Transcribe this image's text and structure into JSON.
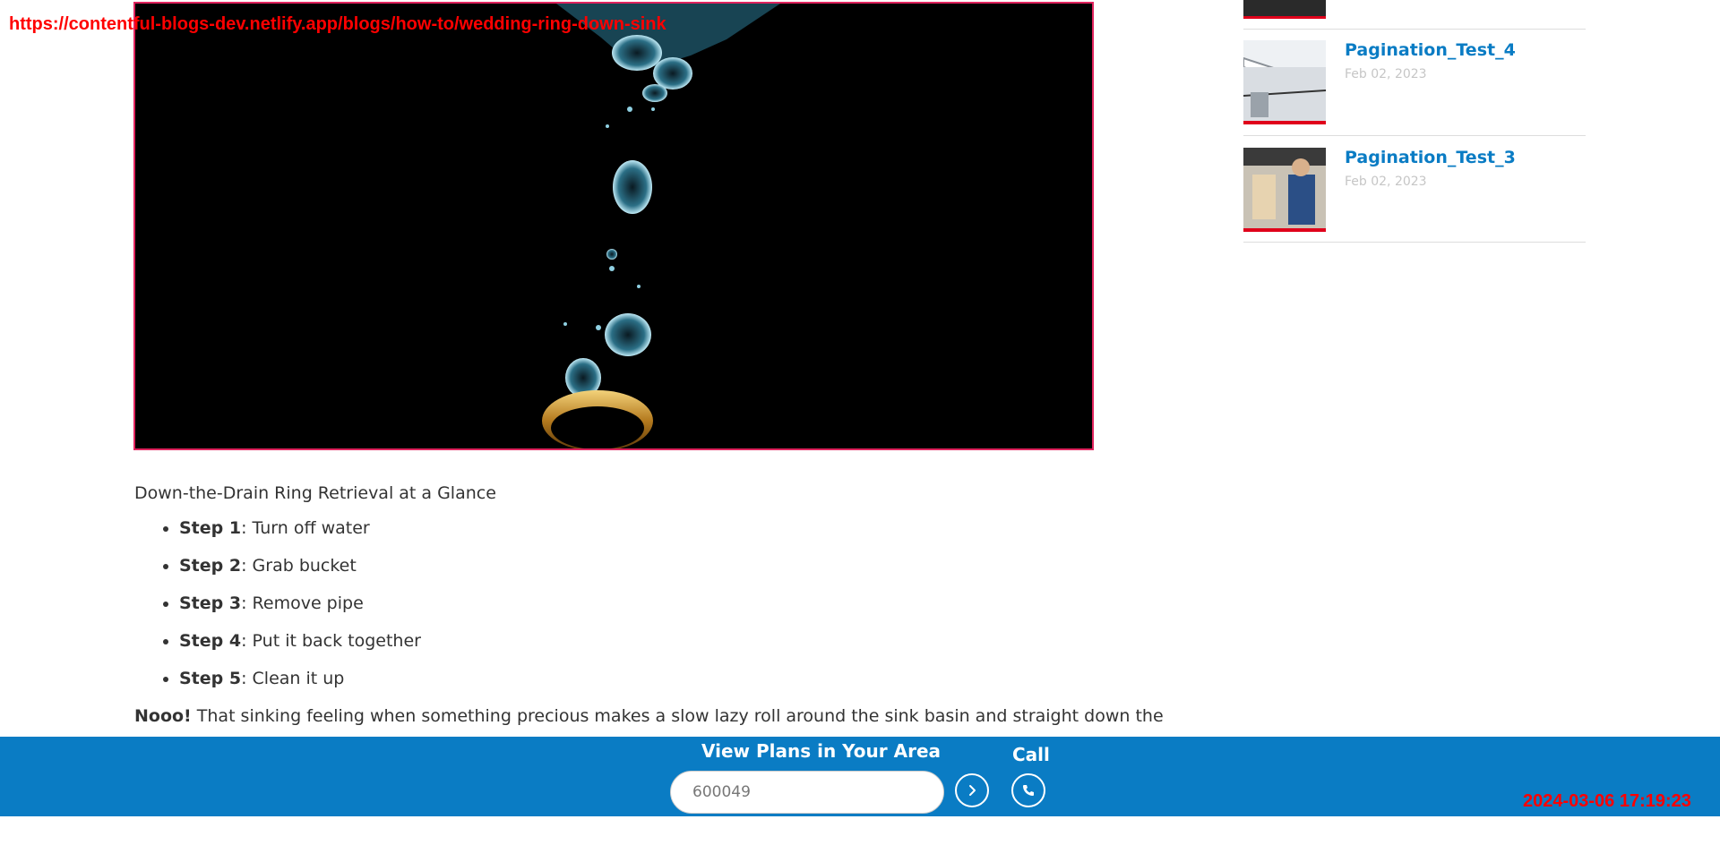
{
  "overlay": {
    "url": "https://contentful-blogs-dev.netlify.app/blogs/how-to/wedding-ring-down-sink",
    "timestamp": "2024-03-06 17:19:23"
  },
  "hero": {
    "alt": "gold ring sinking in water with bubbles"
  },
  "article": {
    "subhead": "Down-the-Drain Ring Retrieval at a Glance",
    "steps": [
      {
        "label": "Step 1",
        "text": ": Turn off water"
      },
      {
        "label": "Step 2",
        "text": ": Grab bucket"
      },
      {
        "label": "Step 3",
        "text": ": Remove pipe"
      },
      {
        "label": "Step 4",
        "text": ": Put it back together"
      },
      {
        "label": "Step 5",
        "text": ": Clean it up"
      }
    ],
    "para_bold": "Nooo!",
    "para_text": " That sinking feeling when something precious makes a slow lazy roll around the sink basin and straight down the"
  },
  "sidebar": {
    "posts": [
      {
        "title": "Pagination_Test_4",
        "date": "Feb 02, 2023",
        "thumb_icon": "house-roof-thumbnail"
      },
      {
        "title": "Pagination_Test_3",
        "date": "Feb 02, 2023",
        "thumb_icon": "technician-thumbnail"
      }
    ]
  },
  "bottom_bar": {
    "title": "View Plans in Your Area",
    "zip_value": "600049",
    "call_label": "Call",
    "go_icon": "chevron-right-icon",
    "call_icon": "phone-icon",
    "color": "#0a7cc4"
  }
}
